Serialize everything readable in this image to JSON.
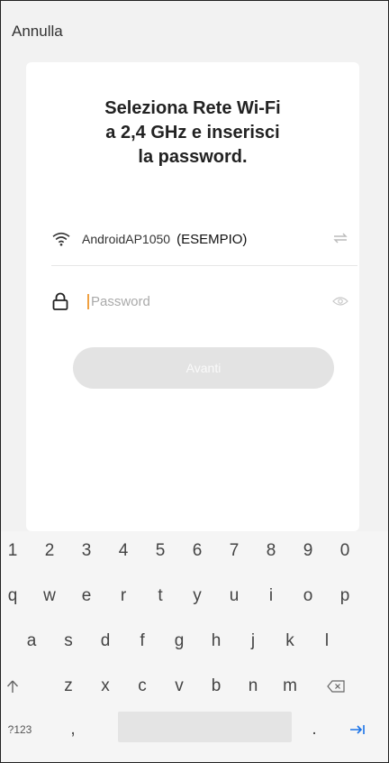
{
  "header": {
    "cancel_label": "Annulla"
  },
  "card": {
    "title_lines": [
      "Seleziona Rete Wi-Fi",
      "a 2,4 GHz e inserisci",
      "la password."
    ],
    "ssid": {
      "name": "AndroidAP1050",
      "example_label": "(ESEMPIO)",
      "icon": "wifi-icon",
      "switch_icon": "swap-icon"
    },
    "password": {
      "placeholder": "Password",
      "value": "",
      "icon": "lock-icon",
      "toggle_icon": "eye-icon"
    },
    "next_button_label": "Avanti"
  },
  "keyboard": {
    "numbers": [
      "1",
      "2",
      "3",
      "4",
      "5",
      "6",
      "7",
      "8",
      "9",
      "0"
    ],
    "row1": [
      "q",
      "w",
      "e",
      "r",
      "t",
      "y",
      "u",
      "i",
      "o",
      "p"
    ],
    "row2": [
      "a",
      "s",
      "d",
      "f",
      "g",
      "h",
      "j",
      "k",
      "l"
    ],
    "row3": [
      "z",
      "x",
      "c",
      "v",
      "b",
      "n",
      "m"
    ],
    "shift_icon": "shift-icon",
    "backspace_icon": "backspace-icon",
    "symbols_label": "?123",
    "comma": ",",
    "period": ".",
    "enter_icon": "tab-next-icon"
  },
  "colors": {
    "accent": "#1a73e8",
    "cursor": "#f0a040",
    "button_disabled": "#e3e3e3"
  }
}
